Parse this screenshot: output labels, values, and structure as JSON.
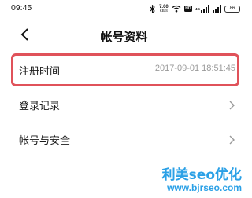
{
  "status_bar": {
    "time": "09:45",
    "network_speed_value": "7.00",
    "network_speed_unit": "KB/S",
    "hd_badge": "HD",
    "signal_label": "4G",
    "battery_level": "86",
    "icons": [
      "bluetooth-icon",
      "wifi-icon",
      "signal-icon",
      "battery-icon"
    ]
  },
  "header": {
    "title": "帐号资料",
    "back_icon": "back-arrow-icon"
  },
  "rows": [
    {
      "label": "注册时间",
      "value": "2017-09-01 18:51:45"
    },
    {
      "label": "登录记录",
      "chevron": "chevron-right-icon"
    },
    {
      "label": "帐号与安全",
      "chevron": "chevron-right-icon"
    }
  ],
  "highlight": {
    "color": "#e0525a"
  },
  "watermark": {
    "line1": "利美seo优化",
    "line2": "www.bjrseo.com",
    "color": "#2aa0e6"
  }
}
